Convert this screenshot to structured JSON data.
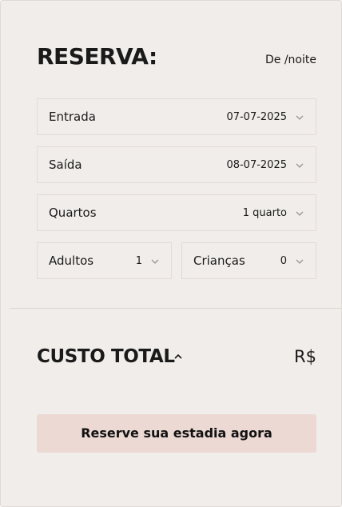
{
  "booking": {
    "title": "RESERVA:",
    "per_night": "De /noite",
    "checkin": {
      "label": "Entrada",
      "value": "07-07-2025"
    },
    "checkout": {
      "label": "Saída",
      "value": "08-07-2025"
    },
    "rooms": {
      "label": "Quartos",
      "value": "1 quarto"
    },
    "adults": {
      "label": "Adultos",
      "value": "1"
    },
    "children": {
      "label": "Crianças",
      "value": "0"
    }
  },
  "total": {
    "label": "CUSTO TOTAL",
    "currency": "R$"
  },
  "cta": {
    "label": "Reserve sua estadia agora"
  },
  "colors": {
    "panel_bg": "#f1edea",
    "field_border": "#e2dbd6",
    "button_bg": "#ecd9d4",
    "text": "#1a1a1a"
  },
  "icons": {
    "dropdown": "chevron-down-icon",
    "expand": "chevron-up-icon"
  }
}
